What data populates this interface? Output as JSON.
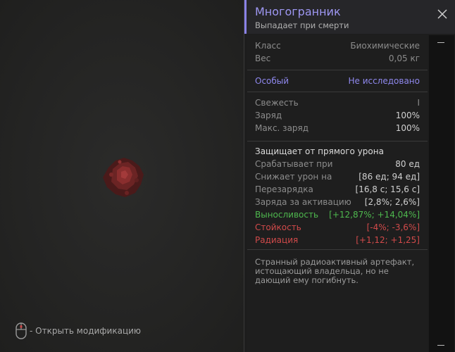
{
  "hint": {
    "text": "- Открыть модификацию",
    "icon": "mouse-icon"
  },
  "header": {
    "title": "Многогранник",
    "subtitle": "Выпадает при смерти",
    "accent_color": "#8a82e6",
    "close_icon": "close-icon"
  },
  "info": [
    {
      "label": "Класс",
      "value": "Биохимические"
    },
    {
      "label": "Вес",
      "value": "0,05 кг"
    }
  ],
  "special": {
    "label": "Особый",
    "value": "Не исследовано",
    "color": "#8f88ee"
  },
  "stats": [
    {
      "label": "Свежесть",
      "value": "I"
    },
    {
      "label": "Заряд",
      "value": "100%"
    },
    {
      "label": "Макс. заряд",
      "value": "100%"
    }
  ],
  "protection": {
    "heading": "Защищает от прямого урона",
    "rows": [
      {
        "label": "Срабатывает при",
        "value": "80 ед"
      },
      {
        "label": "Снижает урон на",
        "value": "[86 ед; 94 ед]"
      },
      {
        "label": "Перезарядка",
        "value": "[16,8 с; 15,6 с]"
      },
      {
        "label": "Заряда за активацию",
        "value": "[2,8%; 2,6%]"
      },
      {
        "label": "Выносливость",
        "value": "[+12,87%; +14,04%]",
        "color": "#4eb84e"
      },
      {
        "label": "Стойкость",
        "value": "[-4%; -3,6%]",
        "color": "#d14a4a"
      },
      {
        "label": "Радиация",
        "value": "[+1,12; +1,25]",
        "color": "#d14a4a"
      }
    ]
  },
  "description": "Странный радиоактивный артефакт, истощающий владельца, но не дающий ему погибнуть."
}
